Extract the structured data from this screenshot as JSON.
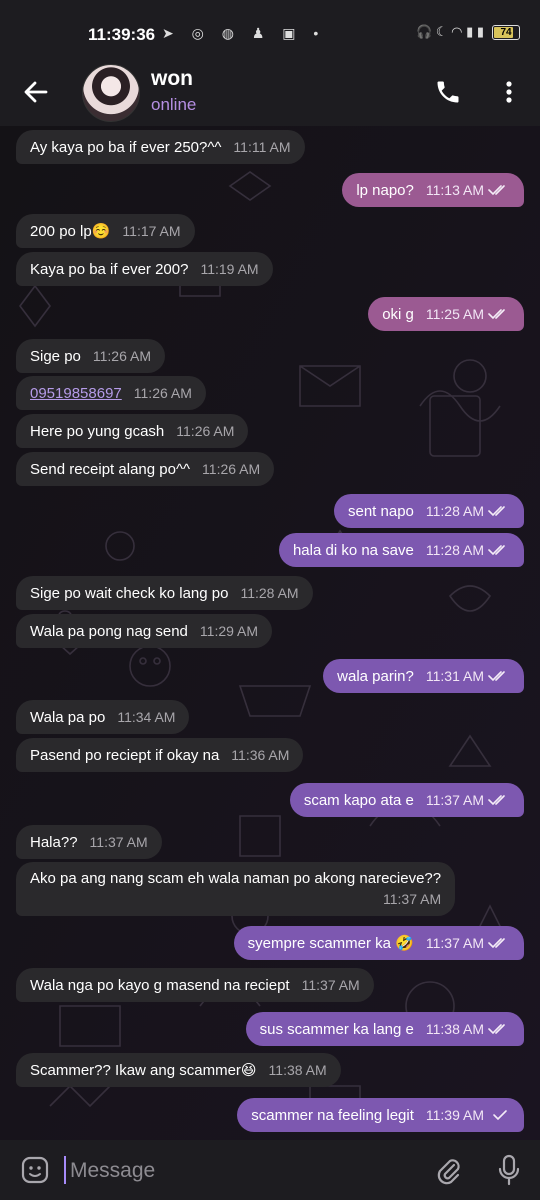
{
  "status_bar": {
    "time": "11:39:36",
    "left_icons": "➤ ◎ ◍ ♟ ▣ •",
    "right_icons": "🎧 ☾ ◠ ▮ ▮",
    "battery": "74"
  },
  "header": {
    "name": "won",
    "status": "online"
  },
  "messages": [
    {
      "dir": "in",
      "text": "Ay kaya po ba if ever 250?^^",
      "time": "11:11 AM"
    },
    {
      "dir": "out",
      "text": "lp napo?",
      "time": "11:13 AM"
    },
    {
      "dir": "in",
      "text": "200 po lp☺️",
      "time": "11:17 AM"
    },
    {
      "dir": "in",
      "text": "Kaya po ba if ever 200?",
      "time": "11:19 AM"
    },
    {
      "dir": "out",
      "text": "oki g",
      "time": "11:25 AM"
    },
    {
      "dir": "in",
      "text": "Sige po",
      "time": "11:26 AM"
    },
    {
      "dir": "in",
      "text": "09519858697",
      "time": "11:26 AM"
    },
    {
      "dir": "in",
      "text": "Here po yung gcash",
      "time": "11:26 AM"
    },
    {
      "dir": "in",
      "text": "Send receipt alang po^^",
      "time": "11:26 AM"
    },
    {
      "dir": "out",
      "text": "sent napo",
      "time": "11:28 AM"
    },
    {
      "dir": "out",
      "text": "hala di ko na save",
      "time": "11:28 AM"
    },
    {
      "dir": "in",
      "text": "Sige po wait check ko lang po",
      "time": "11:28 AM"
    },
    {
      "dir": "in",
      "text": "Wala pa pong nag send",
      "time": "11:29 AM"
    },
    {
      "dir": "out",
      "text": "wala parin?",
      "time": "11:31 AM"
    },
    {
      "dir": "in",
      "text": "Wala pa po",
      "time": "11:34 AM"
    },
    {
      "dir": "in",
      "text": "Pasend po reciept if okay na",
      "time": "11:36 AM"
    },
    {
      "dir": "out",
      "text": "scam kapo ata e",
      "time": "11:37 AM"
    },
    {
      "dir": "in",
      "text": "Hala??",
      "time": "11:37 AM"
    },
    {
      "dir": "in",
      "text": "Ako pa ang nang scam eh wala naman po akong narecieve??",
      "time": "11:37 AM"
    },
    {
      "dir": "out",
      "text": "syempre scammer ka 🤣",
      "time": "11:37 AM"
    },
    {
      "dir": "in",
      "text": "Wala nga po kayo g masend na reciept",
      "time": "11:37 AM"
    },
    {
      "dir": "out",
      "text": "sus scammer ka lang e",
      "time": "11:38 AM"
    },
    {
      "dir": "in",
      "text": "Scammer?? Ikaw ang scammer😆",
      "time": "11:38 AM"
    },
    {
      "dir": "out",
      "text": "scammer na feeling legit",
      "time": "11:39 AM"
    }
  ],
  "composer": {
    "placeholder": "Message"
  },
  "icons": {
    "back": "arrow-left-icon",
    "call": "phone-icon",
    "more": "more-vertical-icon",
    "emoji": "sticker-icon",
    "attach": "paperclip-icon",
    "mic": "microphone-icon"
  },
  "colors": {
    "accent": "#b58ee2",
    "bubble_in": "#2a292c",
    "bubble_out_pink": "#9b5a92",
    "bubble_out_purple": "#7d58b0"
  }
}
